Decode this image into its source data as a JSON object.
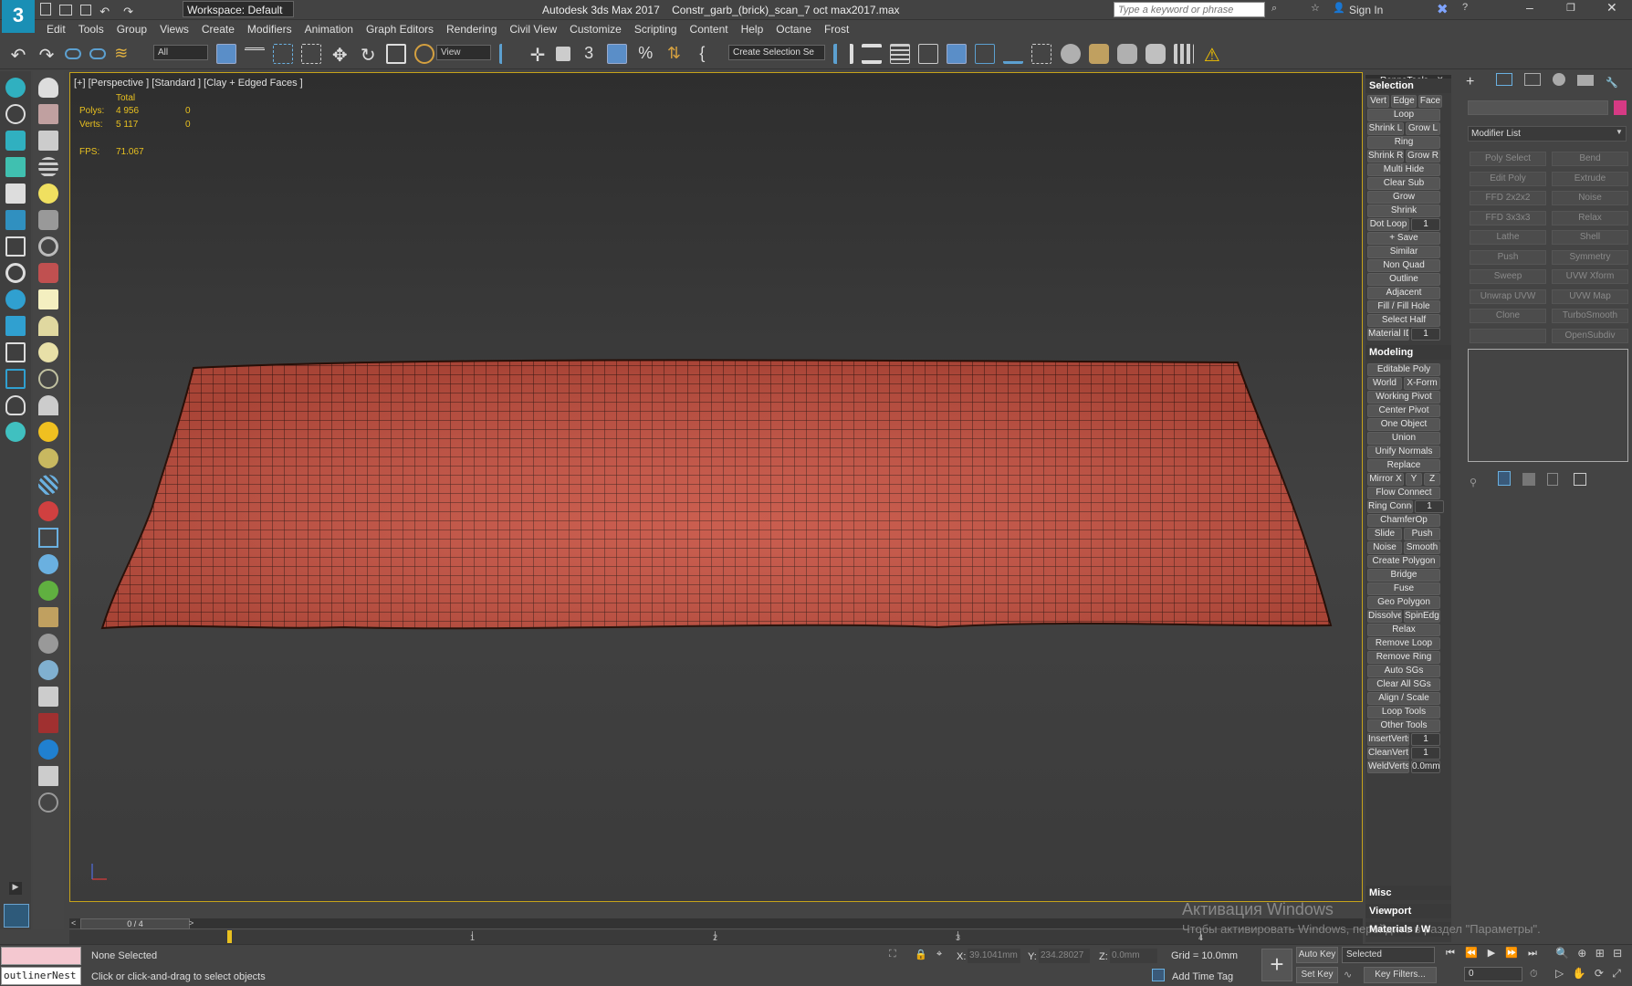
{
  "title": {
    "app": "Autodesk 3ds Max 2017",
    "file": "Constr_garb_(brick)_scan_7 oct max2017.max",
    "workspace": "Workspace: Default",
    "search_placeholder": "Type a keyword or phrase",
    "sign_in": "Sign In",
    "logo": "3"
  },
  "menu": [
    "Edit",
    "Tools",
    "Group",
    "Views",
    "Create",
    "Modifiers",
    "Animation",
    "Graph Editors",
    "Rendering",
    "Civil View",
    "Customize",
    "Scripting",
    "Content",
    "Help",
    "Octane",
    "Frost"
  ],
  "toolbar": {
    "filter": "All",
    "view": "View",
    "selection_set": "Create Selection Se"
  },
  "viewport": {
    "label": "[+] [Perspective ] [Standard ] [Clay + Edged Faces ]",
    "stats": {
      "header": "Total",
      "polys_label": "Polys:",
      "polys": "4 956",
      "polys_sel": "0",
      "verts_label": "Verts:",
      "verts": "5 117",
      "verts_sel": "0",
      "fps_label": "FPS:",
      "fps": "71.067"
    },
    "mesh_color": "#c65040"
  },
  "rappa": {
    "title": "RappaTools",
    "sections": {
      "selection": "Selection",
      "modeling": "Modeling",
      "misc": "Misc",
      "viewport": "Viewport",
      "materials": "Materials / W"
    },
    "selection_buttons": {
      "vert": "Vert",
      "edge": "Edge",
      "face": "Face",
      "loop": "Loop",
      "shrink_l": "Shrink L",
      "grow_l": "Grow L",
      "ring": "Ring",
      "shrink_r": "Shrink R",
      "grow_r": "Grow R",
      "multi_hide": "Multi Hide",
      "clear_sub": "Clear Sub",
      "grow": "Grow",
      "shrink": "Shrink",
      "dot_loop": "Dot Loop",
      "dot_loop_val": "1",
      "save": "+ Save",
      "similar": "Similar",
      "non_quad": "Non Quad",
      "outline": "Outline",
      "adjacent": "Adjacent",
      "fill": "Fill / Fill Hole",
      "select_half": "Select Half",
      "material_id": "Material ID",
      "material_id_val": "1"
    },
    "modeling_buttons": {
      "editable_poly": "Editable Poly",
      "world": "World",
      "xform": "X-Form",
      "working_pivot": "Working Pivot",
      "center_pivot": "Center Pivot",
      "one_object": "One Object",
      "union": "Union",
      "unify_normals": "Unify Normals",
      "replace": "Replace",
      "mirror_x": "Mirror X",
      "y": "Y",
      "z": "Z",
      "flow_connect": "Flow Connect",
      "ring_connect": "Ring Connect",
      "ring_connect_val": "1",
      "chamferop": "ChamferOp",
      "slide": "Slide",
      "push": "Push",
      "noise": "Noise",
      "smooth": "Smooth",
      "create_polygon": "Create Polygon",
      "bridge": "Bridge",
      "fuse": "Fuse",
      "geo_polygon": "Geo Polygon",
      "dissolve": "Dissolve",
      "spinedge": "SpinEdge",
      "relax": "Relax",
      "remove_loop": "Remove Loop",
      "remove_ring": "Remove Ring",
      "auto_sgs": "Auto SGs",
      "clear_all_sgs": "Clear All SGs",
      "align_scale": "Align / Scale",
      "loop_tools": "Loop Tools",
      "other_tools": "Other Tools",
      "insertverts": "InsertVerts",
      "insertverts_val": "1",
      "cleanverts": "CleanVerts",
      "cleanverts_val": "1",
      "weldverts": "WeldVerts",
      "weldverts_val": "0.0mm"
    }
  },
  "command_panel": {
    "modifier_list": "Modifier List",
    "modifiers": [
      "Poly Select",
      "Bend",
      "Edit Poly",
      "Extrude",
      "FFD 2x2x2",
      "Noise",
      "FFD 3x3x3",
      "Relax",
      "Lathe",
      "Shell",
      "Push",
      "Symmetry",
      "Sweep",
      "UVW Xform",
      "Unwrap UVW",
      "UVW Map",
      "Clone",
      "TurboSmooth",
      "",
      "OpenSubdiv"
    ]
  },
  "timeline": {
    "frame": "0 / 4",
    "ticks": [
      "0",
      "1",
      "2",
      "3",
      "4"
    ]
  },
  "status": {
    "selected": "None Selected",
    "prompt": "Click or click-and-drag to select objects",
    "script": "outlinerNest",
    "x_label": "X:",
    "x": "39.1041mm",
    "y_label": "Y:",
    "y": "234.28027",
    "z_label": "Z:",
    "z": "0.0mm",
    "grid": "Grid = 10.0mm",
    "add_time_tag": "Add Time Tag",
    "auto_key": "Auto Key",
    "set_key": "Set Key",
    "selected_dd": "Selected",
    "key_filters": "Key Filters...",
    "frame_field": "0"
  },
  "watermark": {
    "line1": "Активация Windows",
    "line2": "Чтобы активировать Windows, перейдите в раздел \"Параметры\"."
  }
}
